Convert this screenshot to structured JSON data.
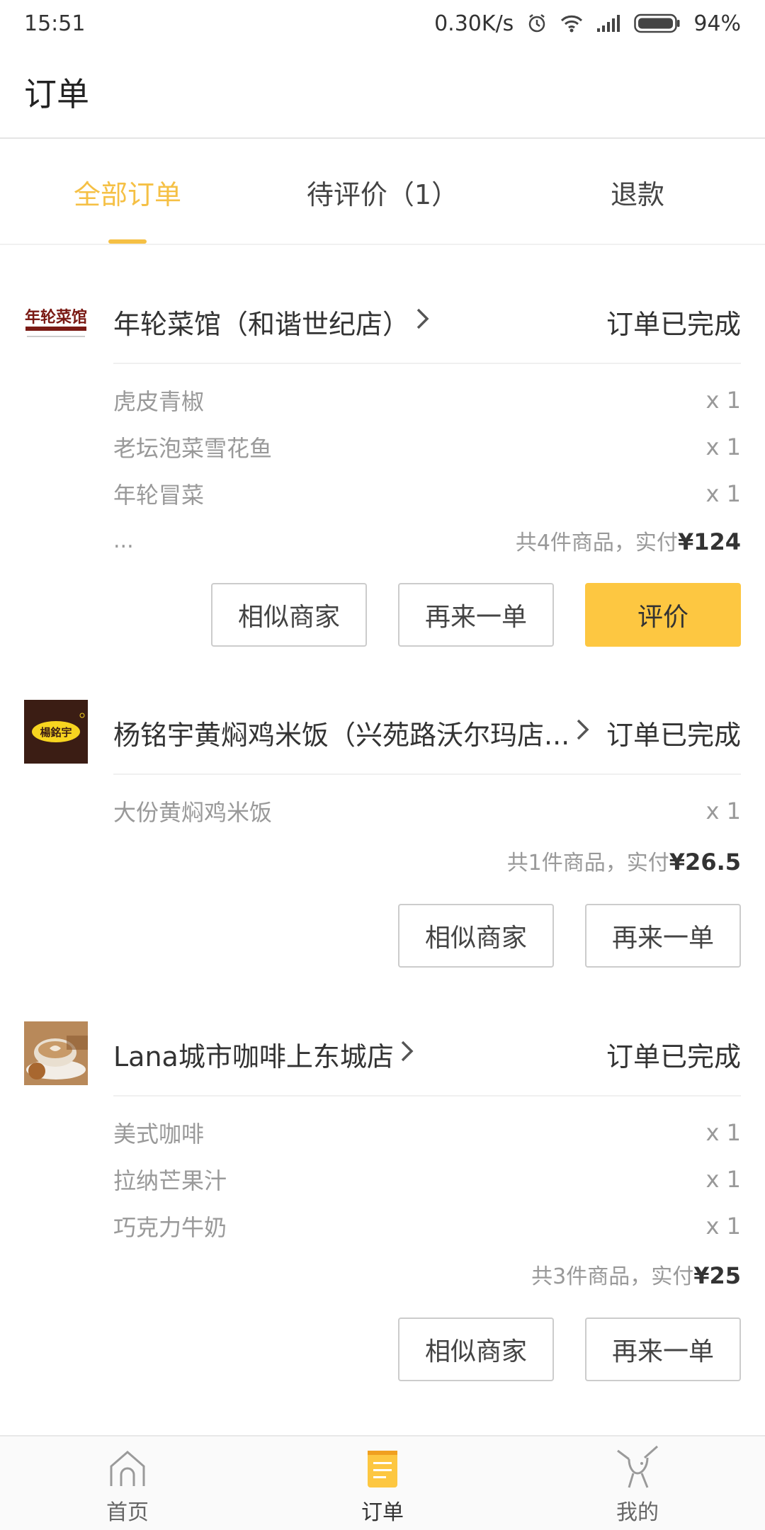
{
  "status_bar": {
    "time": "15:51",
    "net_speed": "0.30K/s",
    "battery": "94%",
    "icons": [
      "alarm-icon",
      "wifi-icon",
      "signal-icon",
      "battery-icon"
    ]
  },
  "header": {
    "title": "订单"
  },
  "tabs": [
    {
      "label": "全部订单",
      "active": true
    },
    {
      "label": "待评价（1）",
      "active": false
    },
    {
      "label": "退款",
      "active": false
    }
  ],
  "orders": [
    {
      "shop": "年轮菜馆（和谐世纪店）",
      "status": "订单已完成",
      "items": [
        {
          "name": "虎皮青椒",
          "qty": "x 1"
        },
        {
          "name": "老坛泡菜雪花鱼",
          "qty": "x 1"
        },
        {
          "name": "年轮冒菜",
          "qty": "x 1"
        }
      ],
      "more": "...",
      "summary_text": "共4件商品，实付",
      "summary_amount": "¥124",
      "buttons": {
        "similar": "相似商家",
        "reorder": "再来一单",
        "review": "评价"
      }
    },
    {
      "shop": "杨铭宇黄焖鸡米饭（兴苑路沃尔玛店...",
      "status": "订单已完成",
      "items": [
        {
          "name": "大份黄焖鸡米饭",
          "qty": "x 1"
        }
      ],
      "summary_text": "共1件商品，实付",
      "summary_amount": "¥26.5",
      "buttons": {
        "similar": "相似商家",
        "reorder": "再来一单"
      }
    },
    {
      "shop": "Lana城市咖啡上东城店",
      "status": "订单已完成",
      "items": [
        {
          "name": "美式咖啡",
          "qty": "x 1"
        },
        {
          "name": "拉纳芒果汁",
          "qty": "x 1"
        },
        {
          "name": "巧克力牛奶",
          "qty": "x 1"
        }
      ],
      "summary_text": "共3件商品，实付",
      "summary_amount": "¥25",
      "buttons": {
        "similar": "相似商家",
        "reorder": "再来一单"
      }
    }
  ],
  "logos": {
    "shop1_text": "年轮菜馆",
    "shop2_text": "楊銘宇"
  },
  "bottom_nav": [
    {
      "label": "首页",
      "icon": "home-icon",
      "active": false
    },
    {
      "label": "订单",
      "icon": "order-icon",
      "active": true
    },
    {
      "label": "我的",
      "icon": "profile-icon",
      "active": false
    }
  ],
  "colors": {
    "accent": "#f5c045",
    "button_primary": "#fdc741"
  }
}
